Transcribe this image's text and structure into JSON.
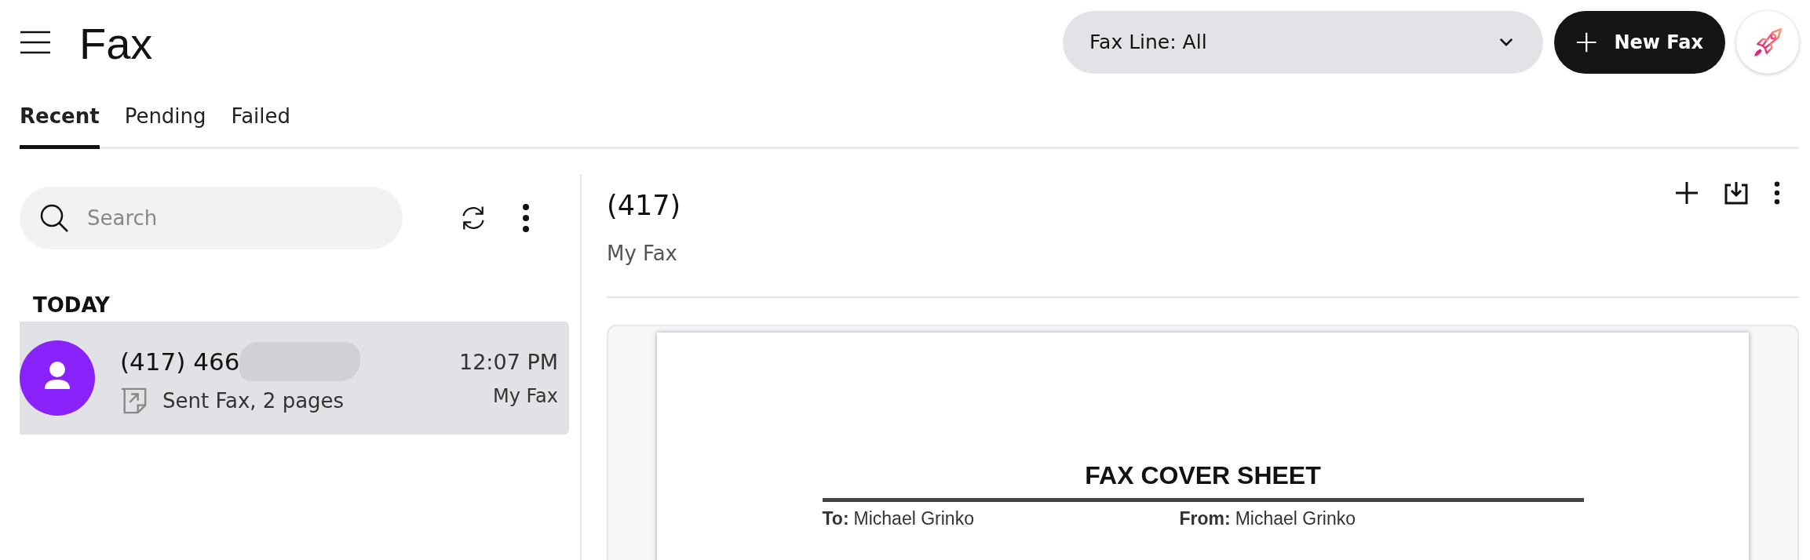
{
  "header": {
    "title": "Fax",
    "fax_line": "Fax Line: All",
    "new_button": "New Fax"
  },
  "tabs": [
    {
      "label": "Recent",
      "selected": true
    },
    {
      "label": "Pending",
      "selected": false
    },
    {
      "label": "Failed",
      "selected": false
    }
  ],
  "search": {
    "placeholder": "Search"
  },
  "groups": [
    {
      "heading": "TODAY",
      "items": [
        {
          "number": "(417) 466",
          "redacted": true,
          "summary": "Sent Fax, 2 pages",
          "time": "12:07 PM",
          "line": "My Fax",
          "selected": true
        }
      ]
    }
  ],
  "detail": {
    "title": "(417)",
    "subtitle": "My Fax",
    "document": {
      "heading": "FAX COVER SHEET",
      "fields": [
        {
          "label": "To:",
          "value": "Michael Grinko"
        },
        {
          "label": "From:",
          "value": "Michael Grinko"
        }
      ]
    }
  }
}
